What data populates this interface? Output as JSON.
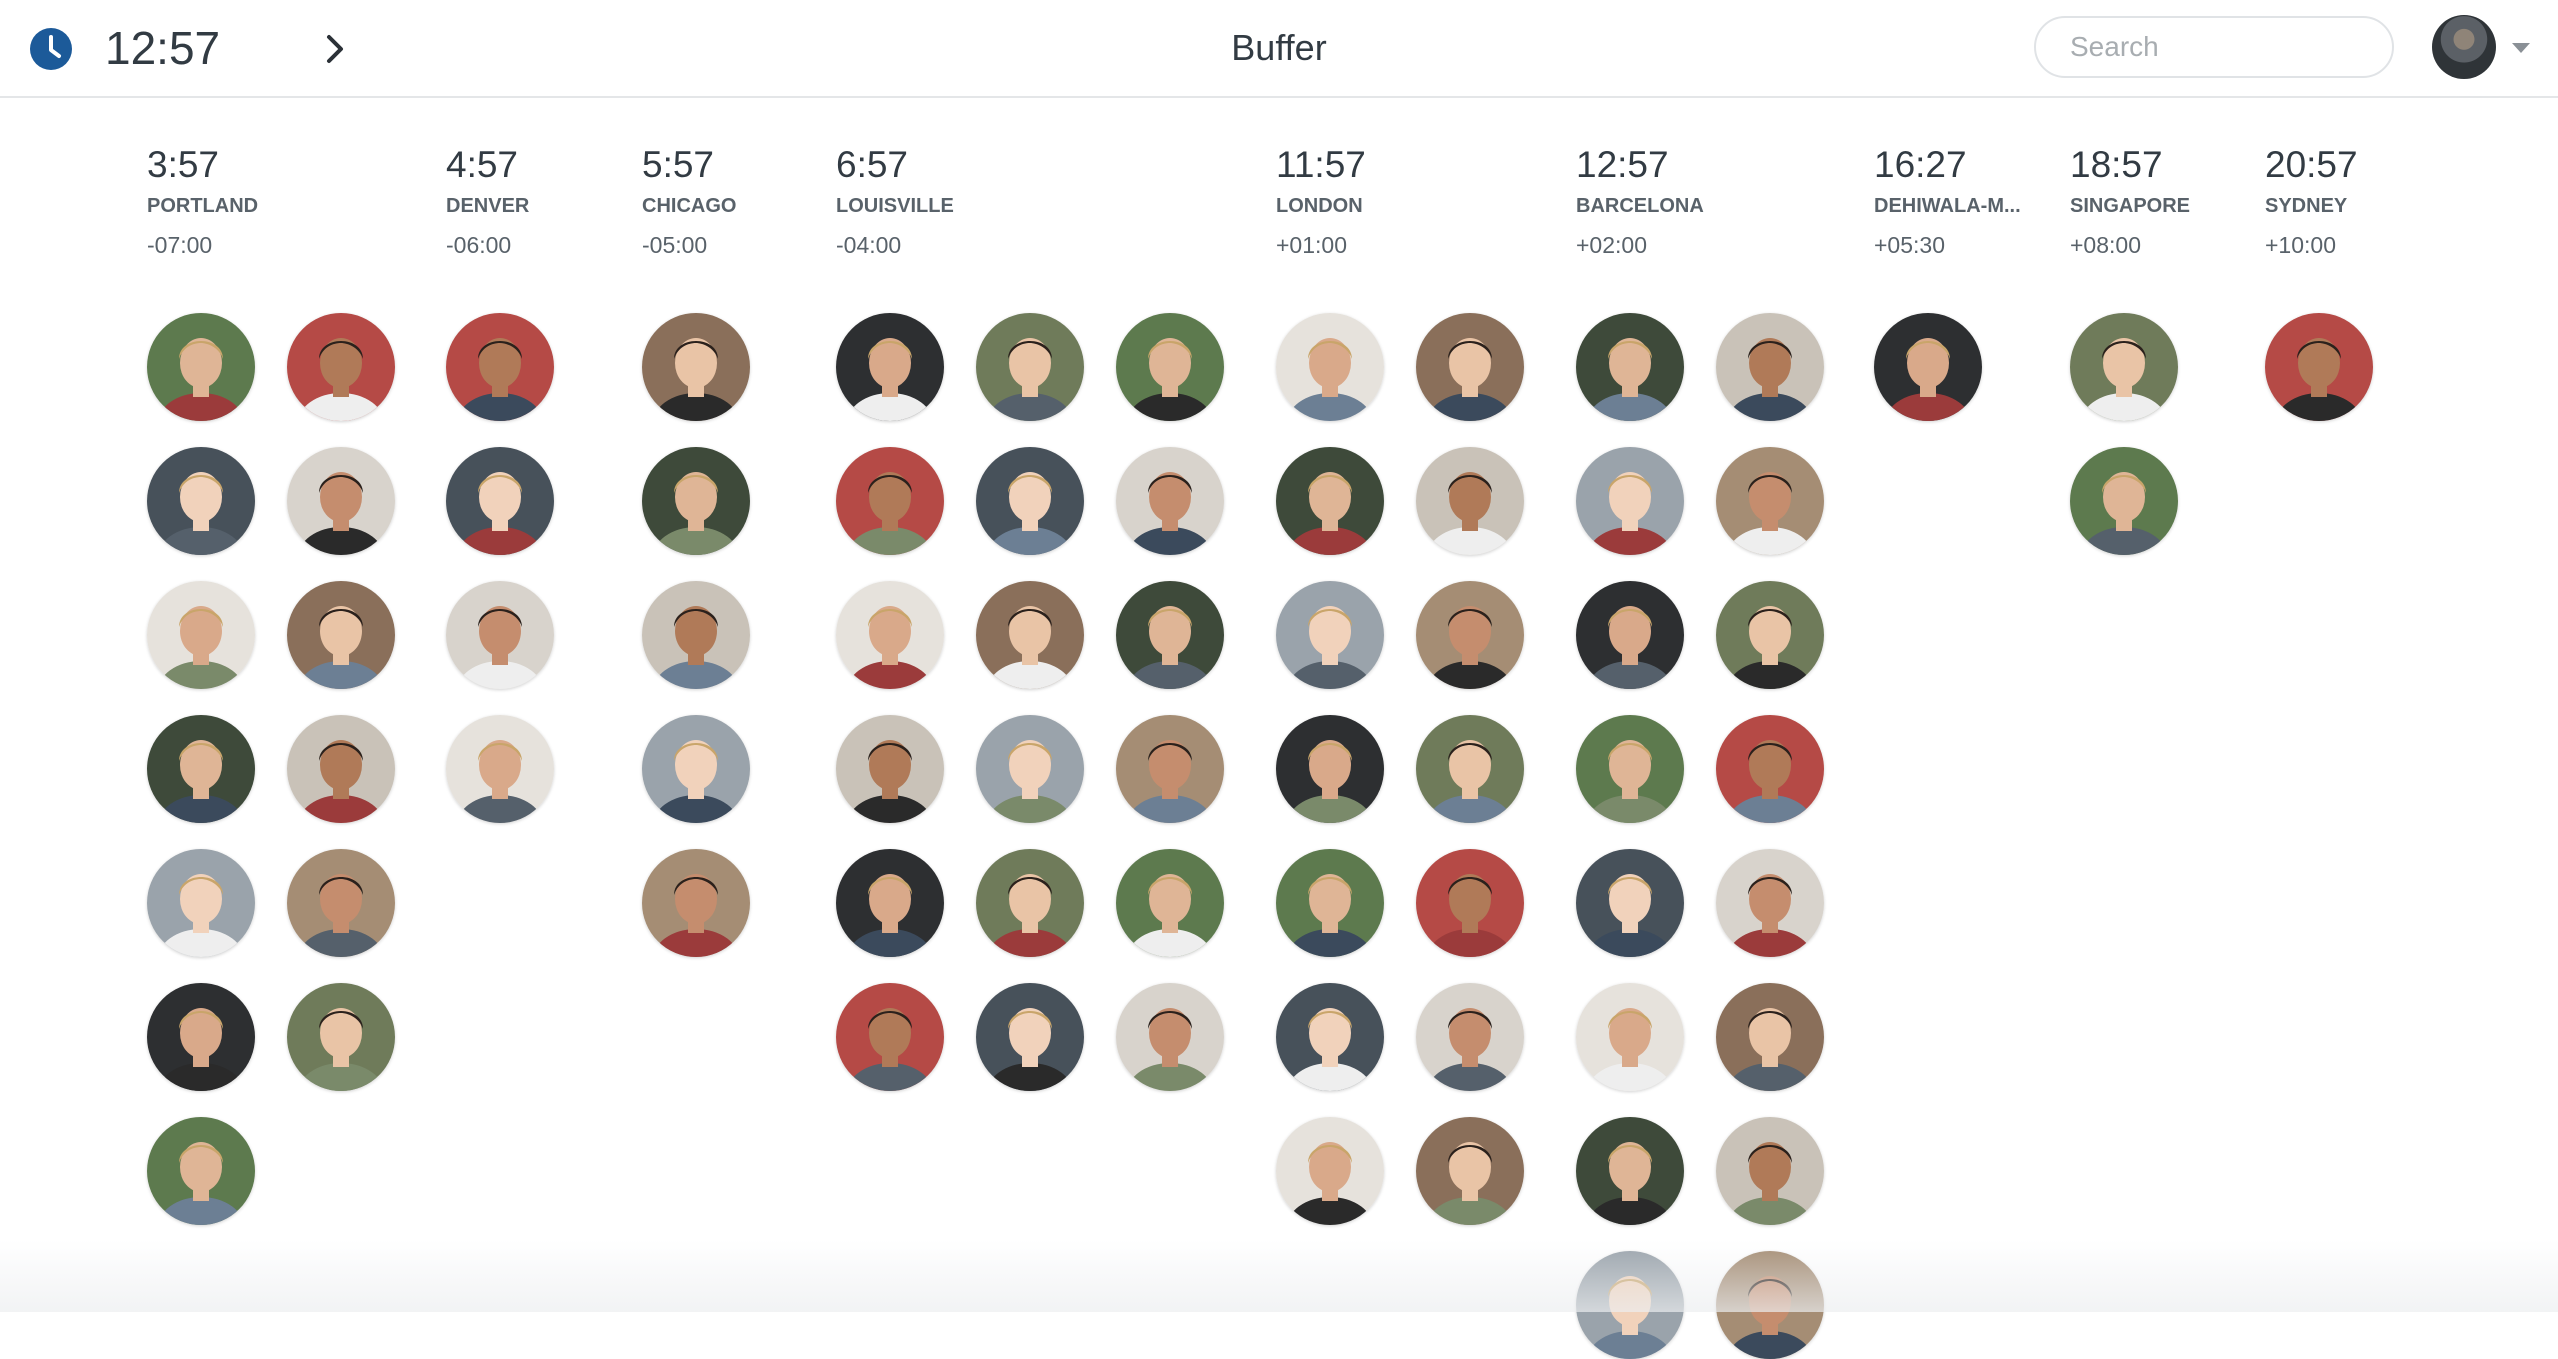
{
  "header": {
    "current_time": "12:57",
    "app_title": "Buffer",
    "search_placeholder": "Search",
    "icons": {
      "clock": "clock-icon",
      "next": "chevron-right-icon",
      "menu": "chevron-down-icon"
    },
    "accent_color": "#1c5a99"
  },
  "timezones": [
    {
      "time": "3:57",
      "city": "PORTLAND",
      "offset": "-07:00",
      "members": 13,
      "cols": 2
    },
    {
      "time": "4:57",
      "city": "DENVER",
      "offset": "-06:00",
      "members": 4,
      "cols": 1
    },
    {
      "time": "5:57",
      "city": "CHICAGO",
      "offset": "-05:00",
      "members": 5,
      "cols": 1
    },
    {
      "time": "6:57",
      "city": "LOUISVILLE",
      "offset": "-04:00",
      "members": 18,
      "cols": 3
    },
    {
      "time": "11:57",
      "city": "LONDON",
      "offset": "+01:00",
      "members": 14,
      "cols": 2
    },
    {
      "time": "12:57",
      "city": "BARCELONA",
      "offset": "+02:00",
      "members": 16,
      "cols": 2
    },
    {
      "time": "16:27",
      "city": "DEHIWALA-M...",
      "offset": "+05:30",
      "members": 1,
      "cols": 1
    },
    {
      "time": "18:57",
      "city": "SINGAPORE",
      "offset": "+08:00",
      "members": 2,
      "cols": 1
    },
    {
      "time": "20:57",
      "city": "SYDNEY",
      "offset": "+10:00",
      "members": 1,
      "cols": 1
    }
  ]
}
